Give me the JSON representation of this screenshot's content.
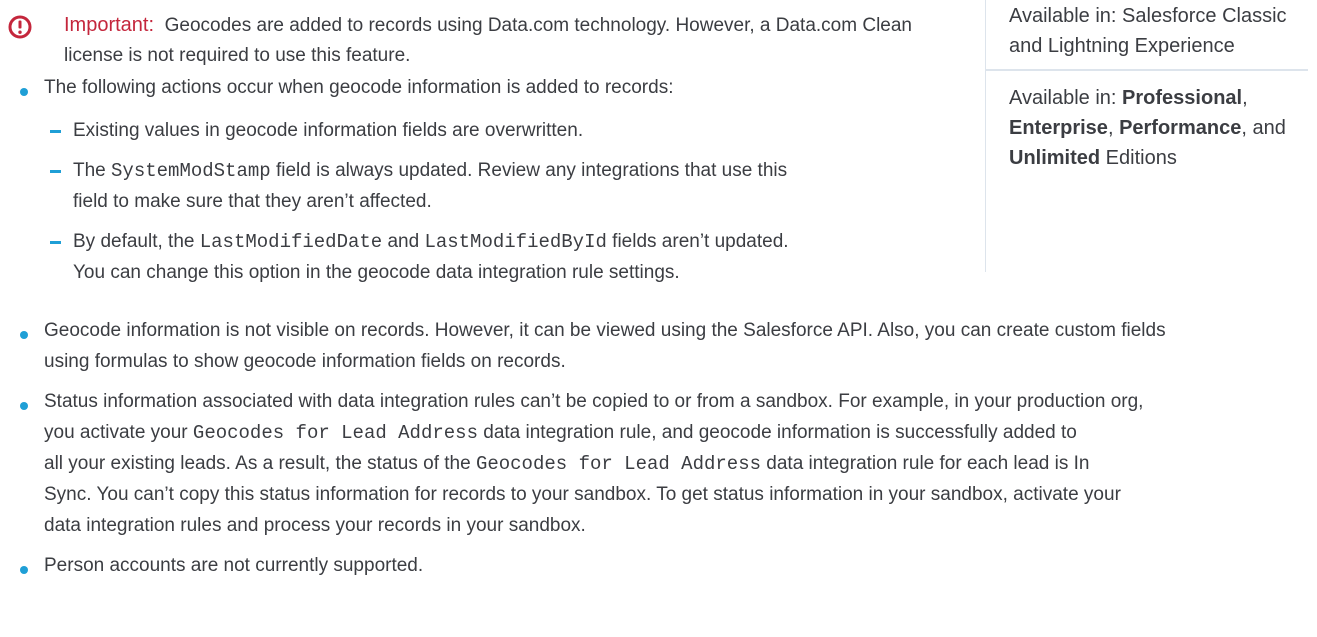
{
  "note": {
    "label": "Important:",
    "text": "Geocodes are added to records using Data.com technology. However, a Data.com Clean license is not required to use this feature."
  },
  "sidebar": {
    "availability_ui": "Available in: Salesforce Classic and Lightning Experience",
    "editions_prefix": "Available in: ",
    "editions": {
      "professional": "Professional",
      "enterprise": "Enterprise",
      "performance": "Performance",
      "unlimited": "Unlimited",
      "sep1": ", ",
      "sep2": ", ",
      "sep3": ", and ",
      "suffix": " Editions"
    }
  },
  "bullets": {
    "actions_intro": "The following actions occur when geocode information is added to records:",
    "sub": {
      "overwrite": "Existing values in geocode information fields are overwritten.",
      "sysmod_pre": "The ",
      "sysmod_code": "SystemModStamp",
      "sysmod_post_line1": " field is always updated. Review any integrations that use this",
      "sysmod_line2": "field to make sure that they aren’t affected.",
      "default_pre": "By default, the ",
      "default_code1": "LastModifiedDate",
      "default_and": " and ",
      "default_code2": "LastModifiedById",
      "default_post": " fields aren’t updated.",
      "default_line2": "You can change this option in the geocode data integration rule settings."
    },
    "visibility_line1": "Geocode information is not visible on records. However, it can be viewed using the Salesforce API. Also, you can create custom fields",
    "visibility_line2": "using formulas to show geocode information fields on records.",
    "status": {
      "line1": "Status information associated with data integration rules can’t be copied to or from a sandbox. For example, in your production org,",
      "line2_pre": "you activate your ",
      "line2_code": "Geocodes for Lead Address",
      "line2_post": " data integration rule, and geocode information is successfully added to",
      "line3_pre": "all your existing leads. As a result, the status of the ",
      "line3_code": "Geocodes for Lead Address",
      "line3_post": " data integration rule for each lead is In",
      "line4": "Sync. You can’t copy this status information for records to your sandbox. To get status information in your sandbox, activate your",
      "line5": "data integration rules and process your records in your sandbox."
    },
    "person": "Person accounts are not currently supported."
  },
  "colors": {
    "accent_blue": "#1f9fd6",
    "important_red": "#c4263c",
    "text": "#3b3d42",
    "divider": "#dde4ec"
  }
}
